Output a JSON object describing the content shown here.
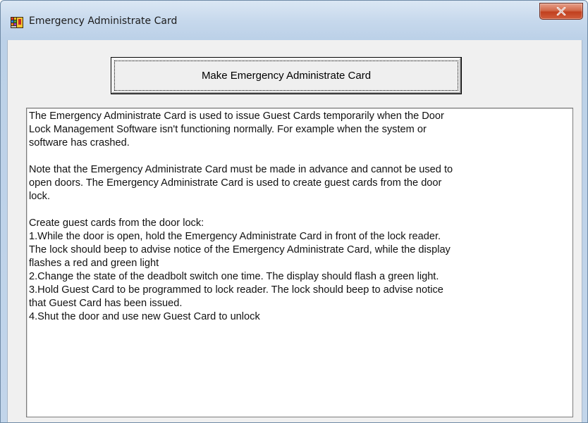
{
  "window": {
    "title": "Emergency Administrate Card",
    "icon": "app-grid-icon",
    "close_icon": "close-x-icon",
    "close_color": "#c7462a"
  },
  "main": {
    "make_card_button_label": "Make Emergency Administrate Card",
    "description": {
      "paragraph1": [
        "The Emergency Administrate Card is used to issue Guest Cards temporarily when the Door",
        "Lock Management Software isn't functioning normally.  For example when the system or",
        "software has crashed."
      ],
      "paragraph2": [
        "Note that the Emergency Administrate Card must be made in advance and cannot be used to",
        "open doors.  The Emergency Administrate Card is used to create guest cards from the door",
        "lock."
      ],
      "paragraph3": [
        "Create guest cards from the door lock:",
        "1.While the door is open, hold the Emergency Administrate Card in front of the lock reader.",
        "The lock should beep to advise notice of the Emergency Administrate Card, while the display",
        "flashes a red and green light",
        "2.Change the state of the deadbolt switch one time.  The display should flash a green light.",
        "3.Hold Guest Card to be programmed to lock reader.  The lock should beep to advise notice",
        "that Guest Card has been issued.",
        "4.Shut the door and use new Guest Card to unlock"
      ]
    }
  }
}
